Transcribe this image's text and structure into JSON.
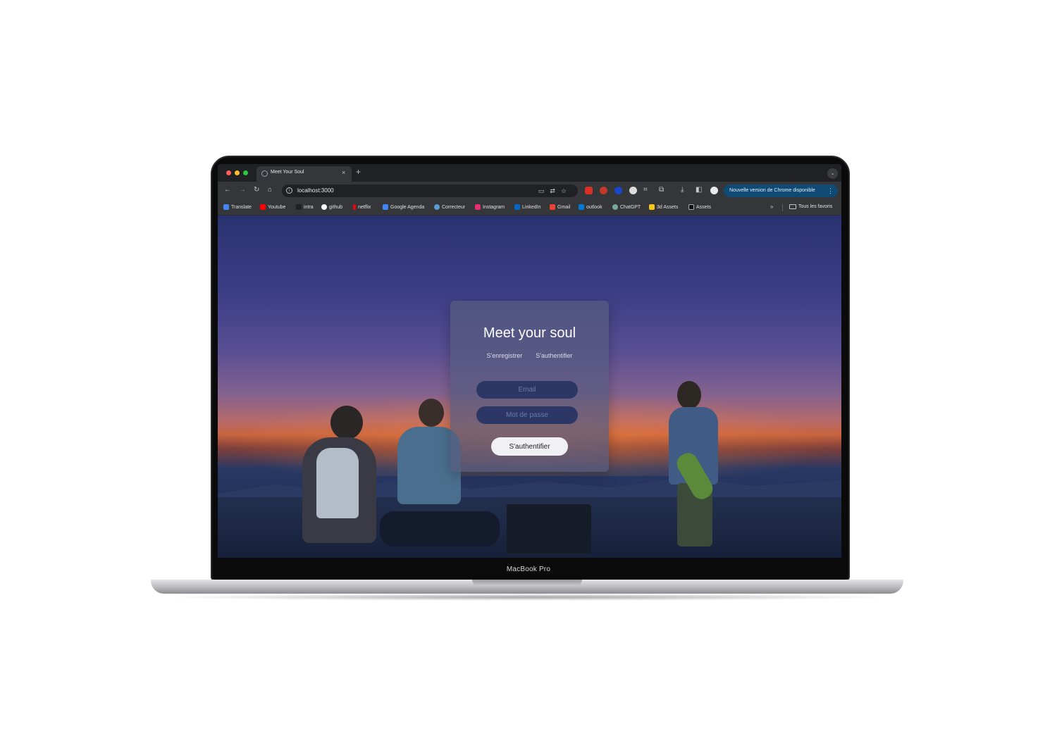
{
  "device": {
    "label": "MacBook Pro"
  },
  "browser": {
    "tab": {
      "title": "Meet Your Soul"
    },
    "new_tab_glyph": "+",
    "tab_close_glyph": "×",
    "address": {
      "url": "localhost:3000"
    },
    "update_notice": "Nouvelle version de Chrome disponible",
    "bookmarks": [
      {
        "label": "Translate",
        "color": "#4285f4"
      },
      {
        "label": "Youtube",
        "color": "#ff0000"
      },
      {
        "label": "intra",
        "color": "#202124"
      },
      {
        "label": "github",
        "color": "#ffffff"
      },
      {
        "label": "netflix",
        "color": "#e50914"
      },
      {
        "label": "Google Agenda",
        "color": "#4285f4"
      },
      {
        "label": "Correcteur",
        "color": "#5b9bd5"
      },
      {
        "label": "Instagram",
        "color": "#e1306c"
      },
      {
        "label": "LinkedIn",
        "color": "#0a66c2"
      },
      {
        "label": "Gmail",
        "color": "#ea4335"
      },
      {
        "label": "outlook",
        "color": "#0078d4"
      },
      {
        "label": "ChatGPT",
        "color": "#74aa9c"
      },
      {
        "label": "3d Assets",
        "color": "#f5c518"
      },
      {
        "label": "Assets",
        "color": "#111111"
      }
    ],
    "bookmarks_overflow": "»",
    "all_bookmarks": "Tous les favoris"
  },
  "page": {
    "title": "Meet your soul",
    "tabs": {
      "register": "S'enregistrer",
      "login": "S'authentifier"
    },
    "email_placeholder": "Email",
    "password_placeholder": "Mot de passe",
    "submit_label": "S'authentifier"
  },
  "colors": {
    "update_pill": "#0e4a73",
    "card": "#585c80",
    "field": "#2c3766",
    "button": "#f1f1f3"
  }
}
